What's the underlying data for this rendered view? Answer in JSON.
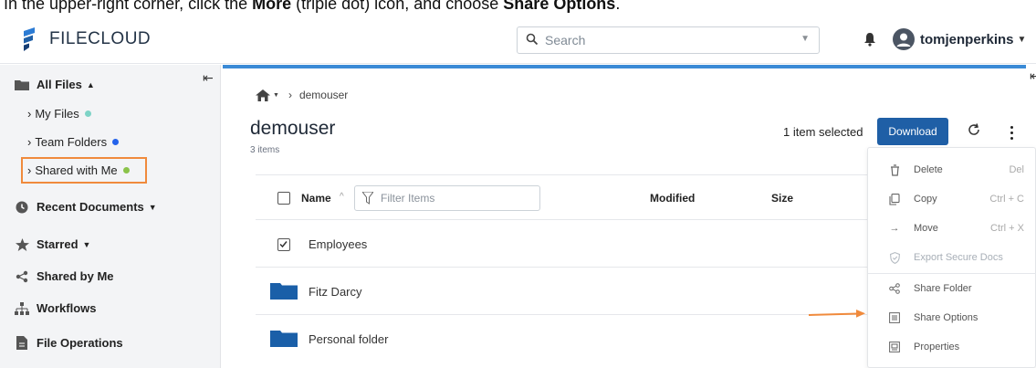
{
  "instruction": {
    "prefix": "In the upper-right corner, click the ",
    "bold1": "More",
    "middle": " (triple dot) icon, and choose ",
    "bold2": "Share Options",
    "suffix": "."
  },
  "header": {
    "logo_text": "FILECLOUD",
    "search_placeholder": "Search",
    "username": "tomjenperkins"
  },
  "sidebar": {
    "all_files": "All Files",
    "my_files": "My Files",
    "team_folders": "Team Folders",
    "shared_with_me": "Shared with Me",
    "recent_documents": "Recent Documents",
    "starred": "Starred",
    "shared_by_me": "Shared by Me",
    "workflows": "Workflows",
    "file_operations": "File Operations"
  },
  "main": {
    "breadcrumb": "demouser",
    "folder_title": "demouser",
    "item_count": "3 items",
    "selected_text": "1 item selected",
    "download_label": "Download",
    "columns": {
      "name": "Name",
      "modified": "Modified",
      "size": "Size"
    },
    "filter_placeholder": "Filter Items",
    "rows": [
      {
        "name": "Employees"
      },
      {
        "name": "Fitz Darcy"
      },
      {
        "name": "Personal folder"
      }
    ]
  },
  "context_menu": {
    "items": [
      {
        "label": "Delete",
        "shortcut": "Del"
      },
      {
        "label": "Copy",
        "shortcut": "Ctrl + C"
      },
      {
        "label": "Move",
        "shortcut": "Ctrl + X"
      },
      {
        "label": "Export Secure Docs",
        "shortcut": ""
      },
      {
        "label": "Share Folder",
        "shortcut": ""
      },
      {
        "label": "Share Options",
        "shortcut": ""
      },
      {
        "label": "Properties",
        "shortcut": ""
      }
    ]
  },
  "colors": {
    "accent": "#1f5fa6",
    "highlight": "#f08a3c",
    "my_files_dot": "#7dd3c6",
    "team_folders_dot": "#2563eb",
    "shared_dot": "#8bc34a",
    "folder": "#1a5fa8"
  }
}
